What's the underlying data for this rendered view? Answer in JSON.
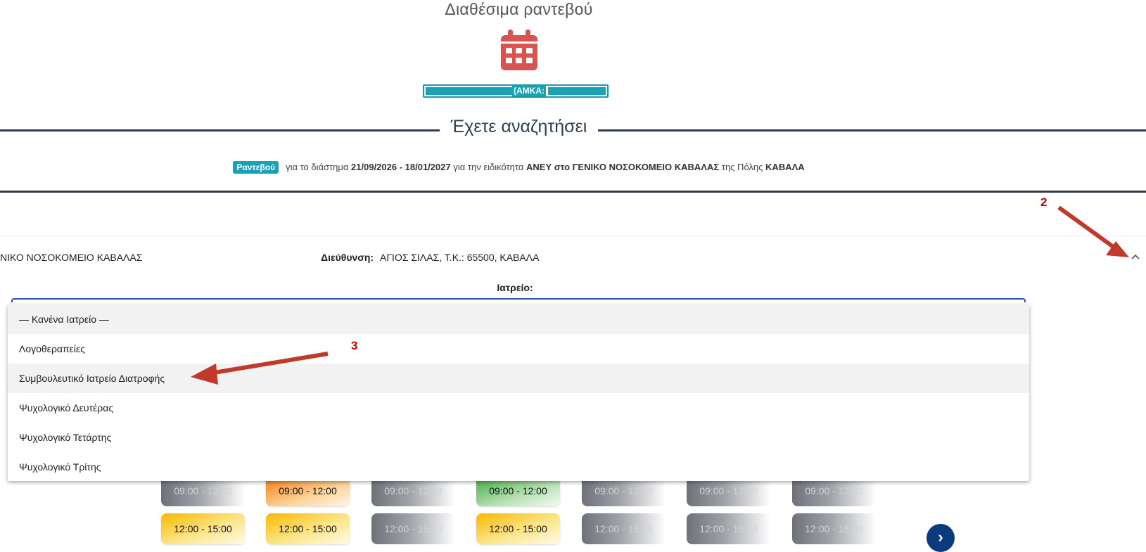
{
  "header": {
    "title": "Διαθέσιμα ραντεβού",
    "amka_label": "(ΑΜΚΑ:"
  },
  "search": {
    "heading": "Έχετε αναζητήσει",
    "badge": "Ραντεβού",
    "text_period_prefix": "για το διάστημα",
    "period": "21/09/2026 - 18/01/2027",
    "text_specialty_prefix": "για την ειδικότητα",
    "specialty": "ΑΝΕΥ στο ΓΕΝΙΚΟ ΝΟΣΟΚΟΜΕΙΟ ΚΑΒΑΛΑΣ",
    "text_city_prefix": "της Πόλης",
    "city": "ΚΑΒΑΛΑ"
  },
  "hospital": {
    "name": "ΝΙΚΟ ΝΟΣΟΚΟΜΕΙΟ ΚΑΒΑΛΑΣ",
    "address_label": "Διεύθυνση:",
    "address": "ΑΓΙΟΣ ΣΙΛΑΣ, Τ.Κ.: 65500, ΚΑΒΑΛΑ",
    "office_label": "Ιατρείο:"
  },
  "dropdown": {
    "options": [
      "— Κανένα Ιατρείο —",
      "Λογοθεραπείες",
      "Συμβουλευτικό Ιατρείο Διατροφής",
      "Ψυχολογικό Δευτέρας",
      "Ψυχολογικό Τετάρτης",
      "Ψυχολογικό Τρίτης"
    ]
  },
  "slots": {
    "row1": [
      {
        "label": "09:00 - 12:00",
        "status": "unavailable"
      },
      {
        "label": "09:00 - 12:00",
        "status": "orange"
      },
      {
        "label": "09:00 - 12:00",
        "status": "unavailable"
      },
      {
        "label": "09:00 - 12:00",
        "status": "green"
      },
      {
        "label": "09:00 - 12:00",
        "status": "unavailable"
      },
      {
        "label": "09:00 - 12:00",
        "status": "unavailable"
      },
      {
        "label": "09:00 - 12:00",
        "status": "unavailable"
      }
    ],
    "row2": [
      {
        "label": "12:00 - 15:00",
        "status": "yellow"
      },
      {
        "label": "12:00 - 15:00",
        "status": "yellow"
      },
      {
        "label": "12:00 - 15:00",
        "status": "unavailable"
      },
      {
        "label": "12:00 - 15:00",
        "status": "yellow"
      },
      {
        "label": "12:00 - 15:00",
        "status": "unavailable"
      },
      {
        "label": "12:00 - 15:00",
        "status": "unavailable"
      },
      {
        "label": "12:00 - 15:00",
        "status": "unavailable"
      }
    ]
  },
  "annotations": {
    "marker_2": "2",
    "marker_3": "3"
  },
  "colors": {
    "calendar_icon": "#d9534f",
    "teal_badge": "#17a2b8",
    "heading_rule": "#2c3e50",
    "select_focus": "#3151b0",
    "next_button": "#0b3a7e",
    "annotation_red": "#c00000"
  },
  "icons": {
    "calendar": "calendar-icon",
    "collapse": "chevron-up-icon",
    "next": "chevron-right-icon"
  }
}
